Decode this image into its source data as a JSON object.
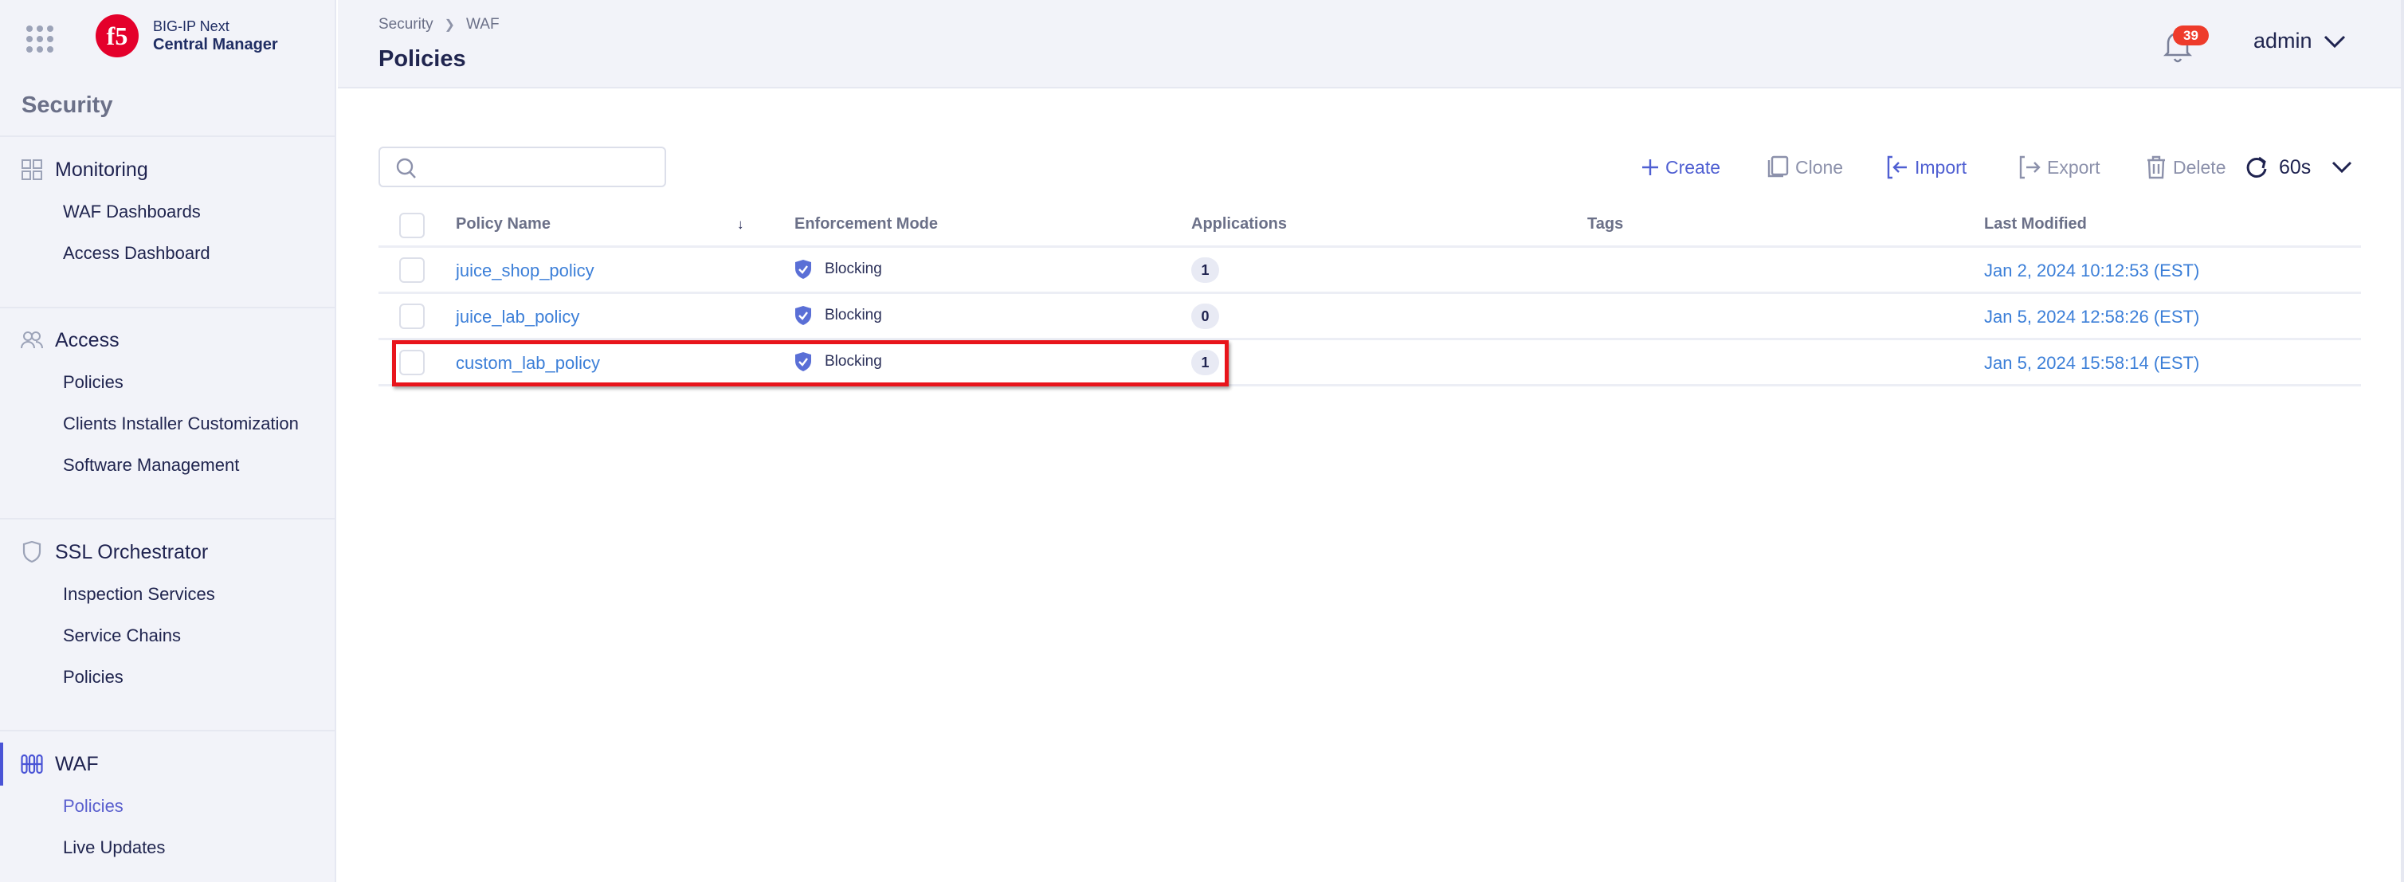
{
  "brand": {
    "line1": "BIG-IP Next",
    "line2": "Central Manager",
    "logo_text": "f5",
    "logo_color": "#e4002b"
  },
  "sidebar": {
    "title": "Security",
    "sections": [
      {
        "label": "Monitoring",
        "icon": "grid-icon",
        "items": [
          {
            "label": "WAF Dashboards"
          },
          {
            "label": "Access Dashboard"
          }
        ]
      },
      {
        "label": "Access",
        "icon": "users-icon",
        "items": [
          {
            "label": "Policies"
          },
          {
            "label": "Clients Installer Customization"
          },
          {
            "label": "Software Management"
          }
        ]
      },
      {
        "label": "SSL Orchestrator",
        "icon": "shield-icon",
        "items": [
          {
            "label": "Inspection Services"
          },
          {
            "label": "Service Chains"
          },
          {
            "label": "Policies"
          }
        ]
      },
      {
        "label": "WAF",
        "icon": "waf-icon",
        "active": true,
        "items": [
          {
            "label": "Policies",
            "active": true
          },
          {
            "label": "Live Updates"
          }
        ]
      }
    ]
  },
  "header": {
    "breadcrumb": [
      "Security",
      "WAF"
    ],
    "title": "Policies",
    "notifications_count": "39",
    "user": "admin"
  },
  "toolbar": {
    "search_placeholder": "",
    "create": "Create",
    "clone": "Clone",
    "import": "Import",
    "export": "Export",
    "delete": "Delete",
    "refresh_interval": "60s"
  },
  "table": {
    "columns": [
      "Policy Name",
      "Enforcement Mode",
      "Applications",
      "Tags",
      "Last Modified"
    ],
    "sort_column": "Policy Name",
    "sort_direction": "descending",
    "rows": [
      {
        "name": "juice_shop_policy",
        "mode": "Blocking",
        "applications": "1",
        "tags": "",
        "last_modified": "Jan 2, 2024 10:12:53 (EST)"
      },
      {
        "name": "juice_lab_policy",
        "mode": "Blocking",
        "applications": "0",
        "tags": "",
        "last_modified": "Jan 5, 2024 12:58:26 (EST)"
      },
      {
        "name": "custom_lab_policy",
        "mode": "Blocking",
        "applications": "1",
        "tags": "",
        "last_modified": "Jan 5, 2024 15:58:14 (EST)",
        "highlighted": true
      }
    ]
  },
  "colors": {
    "accent": "#4f5fd2",
    "link": "#3c7fd8",
    "badge": "#ee3b2b",
    "highlight_box": "#e8141b",
    "sidebar_bg": "#f2f3f9"
  }
}
